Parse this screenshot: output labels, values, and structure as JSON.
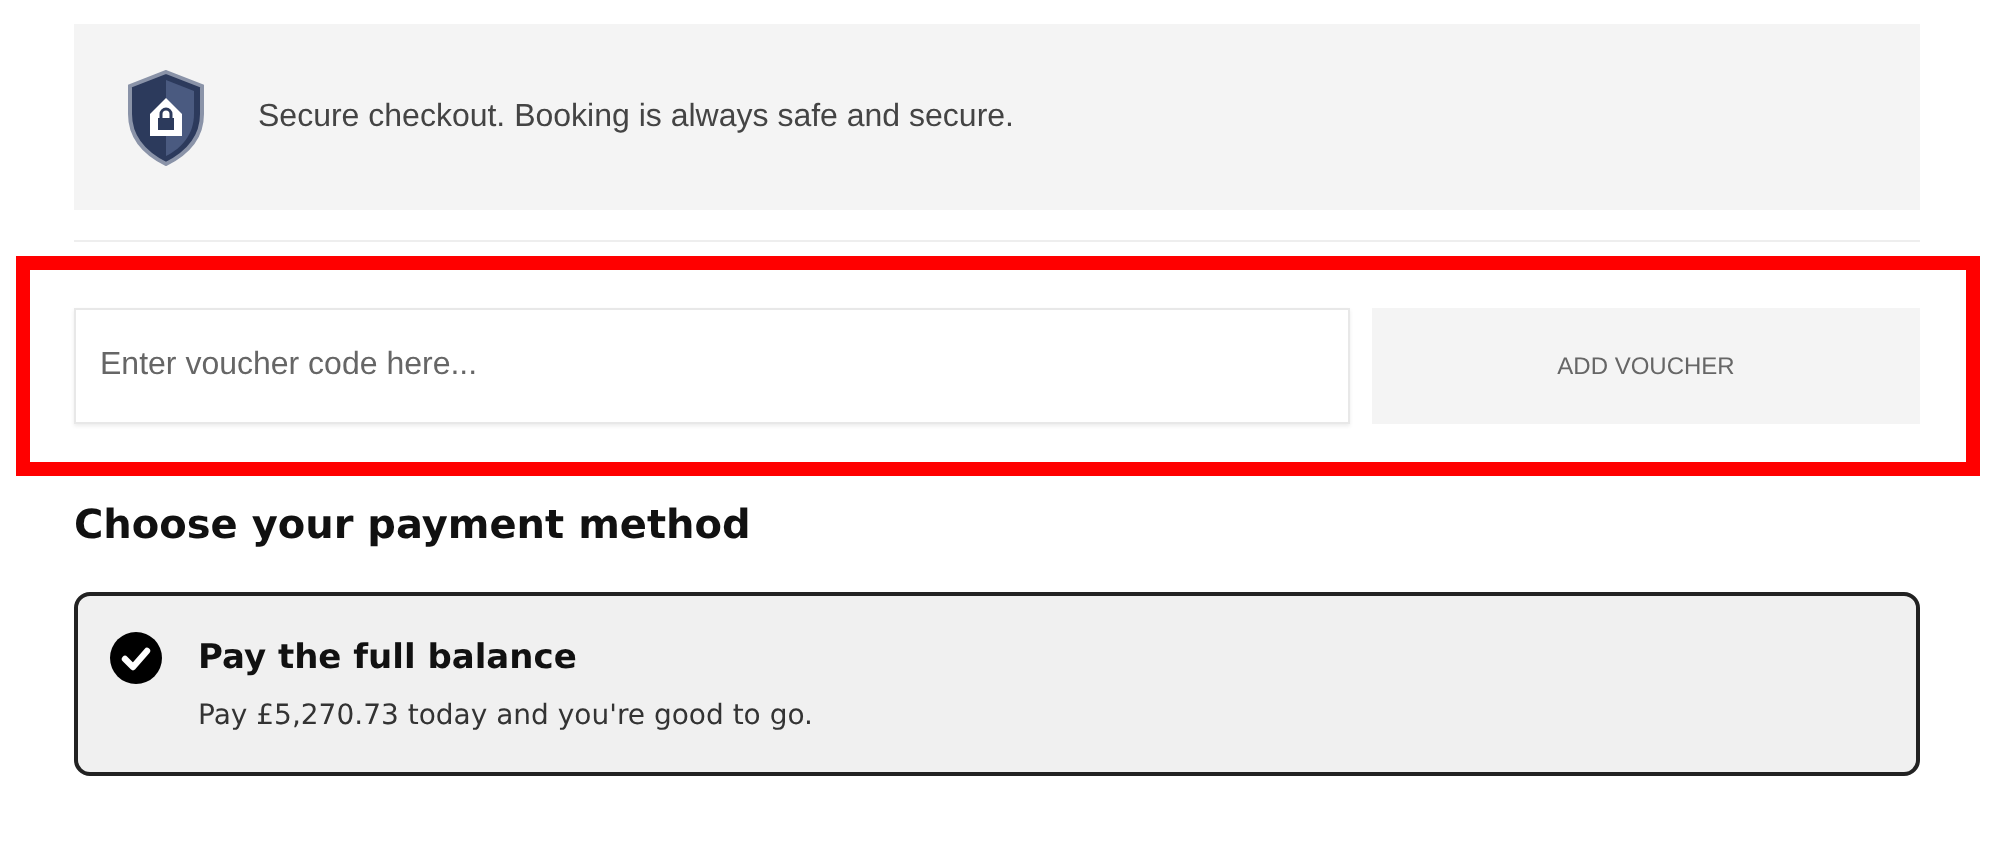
{
  "secure_banner": {
    "text": "Secure checkout. Booking is always safe and secure."
  },
  "voucher": {
    "highlighted": true,
    "placeholder": "Enter voucher code here...",
    "button": "ADD VOUCHER"
  },
  "payment": {
    "heading": "Choose your payment method",
    "options": [
      {
        "title": "Pay the full balance",
        "description": "Pay £5,270.73 today and you're good to go.",
        "selected": true
      }
    ]
  }
}
